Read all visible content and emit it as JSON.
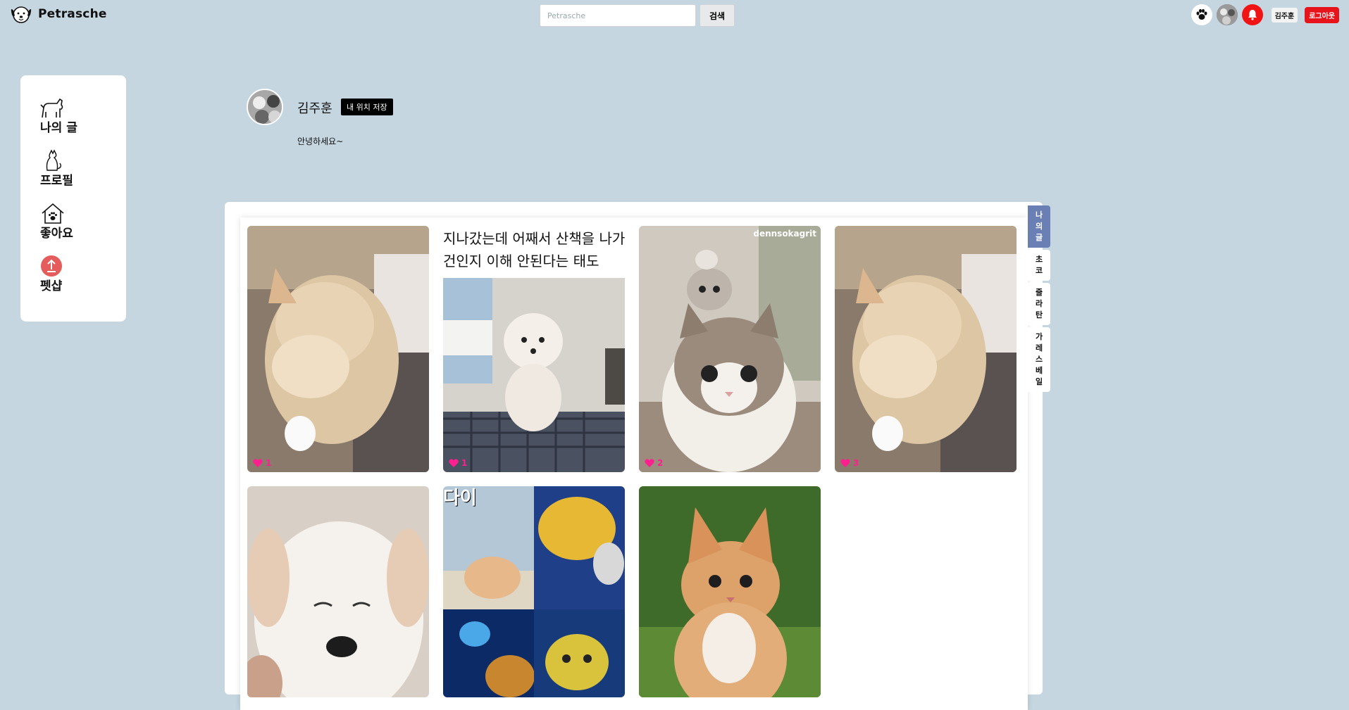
{
  "header": {
    "logo_text": "Petrasche",
    "search_placeholder": "Petrasche",
    "search_button": "검색",
    "username": "김주훈",
    "logout": "로그아웃"
  },
  "sidebar": {
    "items": [
      {
        "label": "나의 글",
        "icon": "dog-icon"
      },
      {
        "label": "프로필",
        "icon": "cat-icon"
      },
      {
        "label": "좋아요",
        "icon": "pet-house-icon"
      },
      {
        "label": "펫샵",
        "icon": "upload-icon"
      }
    ]
  },
  "profile": {
    "name": "김주훈",
    "save_location_button": "내 위치 저장",
    "bio": "안녕하세요~"
  },
  "posts": [
    {
      "likes": "1",
      "subject": "cat"
    },
    {
      "likes": "1",
      "subject": "poodle",
      "caption_line1": "지나갔는데 어째서 산책을 나가",
      "caption_line2": "건인지 이해 안된다는 태도"
    },
    {
      "likes": "2",
      "subject": "stacked-cats",
      "watermark": "dennsokagrit"
    },
    {
      "likes": "3",
      "subject": "cat"
    },
    {
      "subject": "puppy"
    },
    {
      "subject": "collage",
      "collage_text": "다이"
    },
    {
      "subject": "kitten"
    }
  ],
  "side_tabs": [
    {
      "label": "나의글",
      "chars": [
        "나",
        "의",
        "글"
      ],
      "active": true
    },
    {
      "label": "초코",
      "chars": [
        "초",
        "코"
      ]
    },
    {
      "label": "줄라탄",
      "chars": [
        "줄",
        "라",
        "탄"
      ]
    },
    {
      "label": "가레스베일",
      "chars": [
        "가",
        "레",
        "스",
        "베",
        "일"
      ]
    }
  ],
  "colors": {
    "page_bg": "#c5d6e0",
    "logout_bg": "#e8141c",
    "bell_bg": "#f01414",
    "active_tab": "#6a7fb3",
    "heart": "#ff1f8e"
  }
}
